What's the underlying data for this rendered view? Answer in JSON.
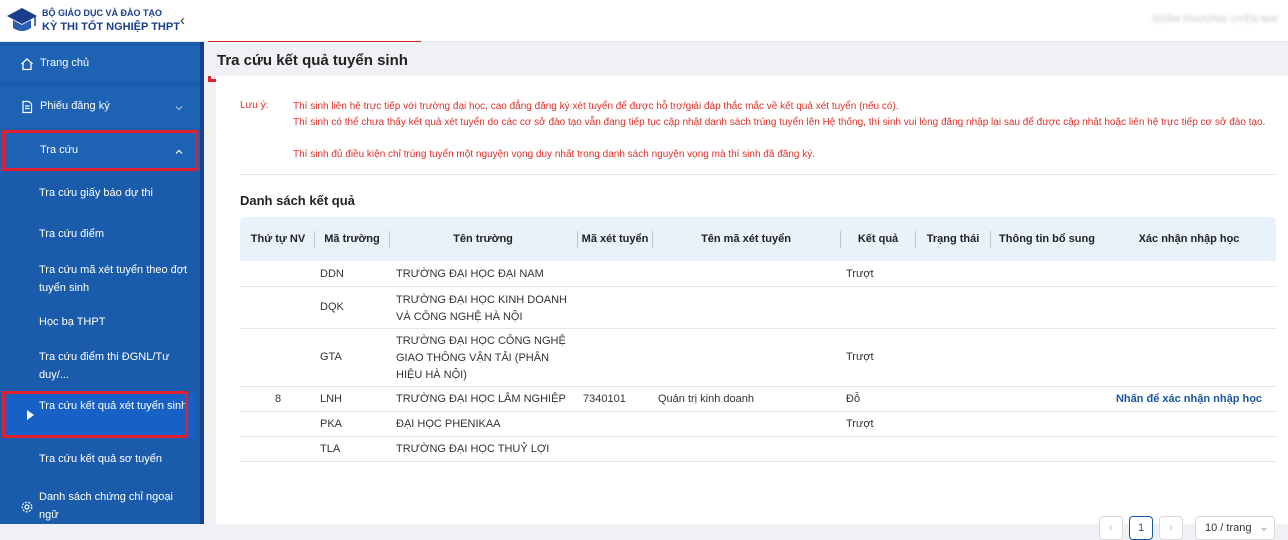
{
  "header": {
    "org": "BỘ GIÁO DỤC VÀ ĐÀO TẠO",
    "app": "KỲ THI TỐT NGHIỆP THPT",
    "collapse_glyph": "‹",
    "user_name": "DOÃN PHƯƠNG UYÊN NHI"
  },
  "sidebar": {
    "home": "Trang chủ",
    "registration": "Phiếu đăng ký",
    "lookup": "Tra cứu",
    "sub_items": [
      "Tra cứu giấy báo dự thi",
      "Tra cứu điểm",
      "Tra cứu mã xét tuyển theo đợt tuyển sinh",
      "Học bạ THPT",
      "Tra cứu điểm thi ĐGNL/Tư duy/...",
      "Tra cứu kết quả xét tuyển sinh",
      "Tra cứu kết quả sơ tuyển"
    ],
    "certificates": "Danh sách chứng chỉ ngoại ngữ"
  },
  "main": {
    "title": "Tra cứu kết quả tuyển sinh",
    "note_label": "Lưu ý:",
    "notes": [
      "Thí sinh liên hệ trực tiếp với trường đại học, cao đẳng đăng ký xét tuyển để được hỗ trợ/giải đáp thắc mắc về kết quả xét tuyển (nếu có).",
      "Thí sinh có thể chưa thấy kết quả xét tuyển do các cơ sở đào tạo vẫn đang tiếp tục cập nhật danh sách trúng tuyển lên Hệ thống, thí sinh vui lòng đăng nhập lại sau để được cập nhật hoặc liên hệ trực tiếp cơ sở đào tạo.",
      "Thí sinh đủ điều kiện chỉ trúng tuyển một nguyện vọng duy nhất trong danh sách nguyện vọng mà thí sinh đã đăng ký."
    ],
    "list_title": "Danh sách kết quả",
    "columns": [
      "Thứ tự NV",
      "Mã trường",
      "Tên trường",
      "Mã xét tuyển",
      "Tên mã xét tuyển",
      "Kết quả",
      "Trạng thái",
      "Thông tin bổ sung",
      "Xác nhận nhập học"
    ],
    "rows": [
      {
        "nv": "",
        "code": "DDN",
        "school": "TRƯỜNG ĐẠI HỌC ĐẠI NAM",
        "adm": "",
        "adm_name": "",
        "result": "Trượt",
        "status": "",
        "extra": "",
        "confirm": ""
      },
      {
        "nv": "",
        "code": "DQK",
        "school": "TRƯỜNG ĐẠI HỌC KINH DOANH VÀ CÔNG NGHỆ HÀ NỘI",
        "adm": "",
        "adm_name": "",
        "result": "",
        "status": "",
        "extra": "",
        "confirm": ""
      },
      {
        "nv": "",
        "code": "GTA",
        "school": "TRƯỜNG ĐẠI HỌC CÔNG NGHỆ GIAO THÔNG VẬN TẢI (PHÂN HIỆU HÀ NỘI)",
        "adm": "",
        "adm_name": "",
        "result": "Trượt",
        "status": "",
        "extra": "",
        "confirm": ""
      },
      {
        "nv": "8",
        "code": "LNH",
        "school": "TRƯỜNG ĐẠI HỌC LÂM NGHIỆP",
        "adm": "7340101",
        "adm_name": "Quản trị kinh doanh",
        "result": "Đỗ",
        "status": "",
        "extra": "",
        "confirm": "Nhấn để xác nhận nhập học"
      },
      {
        "nv": "",
        "code": "PKA",
        "school": "ĐẠI HỌC PHENIKAA",
        "adm": "",
        "adm_name": "",
        "result": "Trượt",
        "status": "",
        "extra": "",
        "confirm": ""
      },
      {
        "nv": "",
        "code": "TLA",
        "school": "TRƯỜNG ĐẠI HỌC THUỶ LỢI",
        "adm": "",
        "adm_name": "",
        "result": "",
        "status": "",
        "extra": "",
        "confirm": ""
      }
    ],
    "pagination": {
      "prev": "‹",
      "current": "1",
      "next": "›",
      "page_size": "10 / trang"
    }
  },
  "icons": {
    "home": "home-icon",
    "form": "document-icon",
    "settings": "gear-icon"
  },
  "colors": {
    "sidebar": "#1a5cab",
    "accent": "#1a56a6",
    "warning": "#e0302a",
    "highlight_frame": "#e02030"
  }
}
